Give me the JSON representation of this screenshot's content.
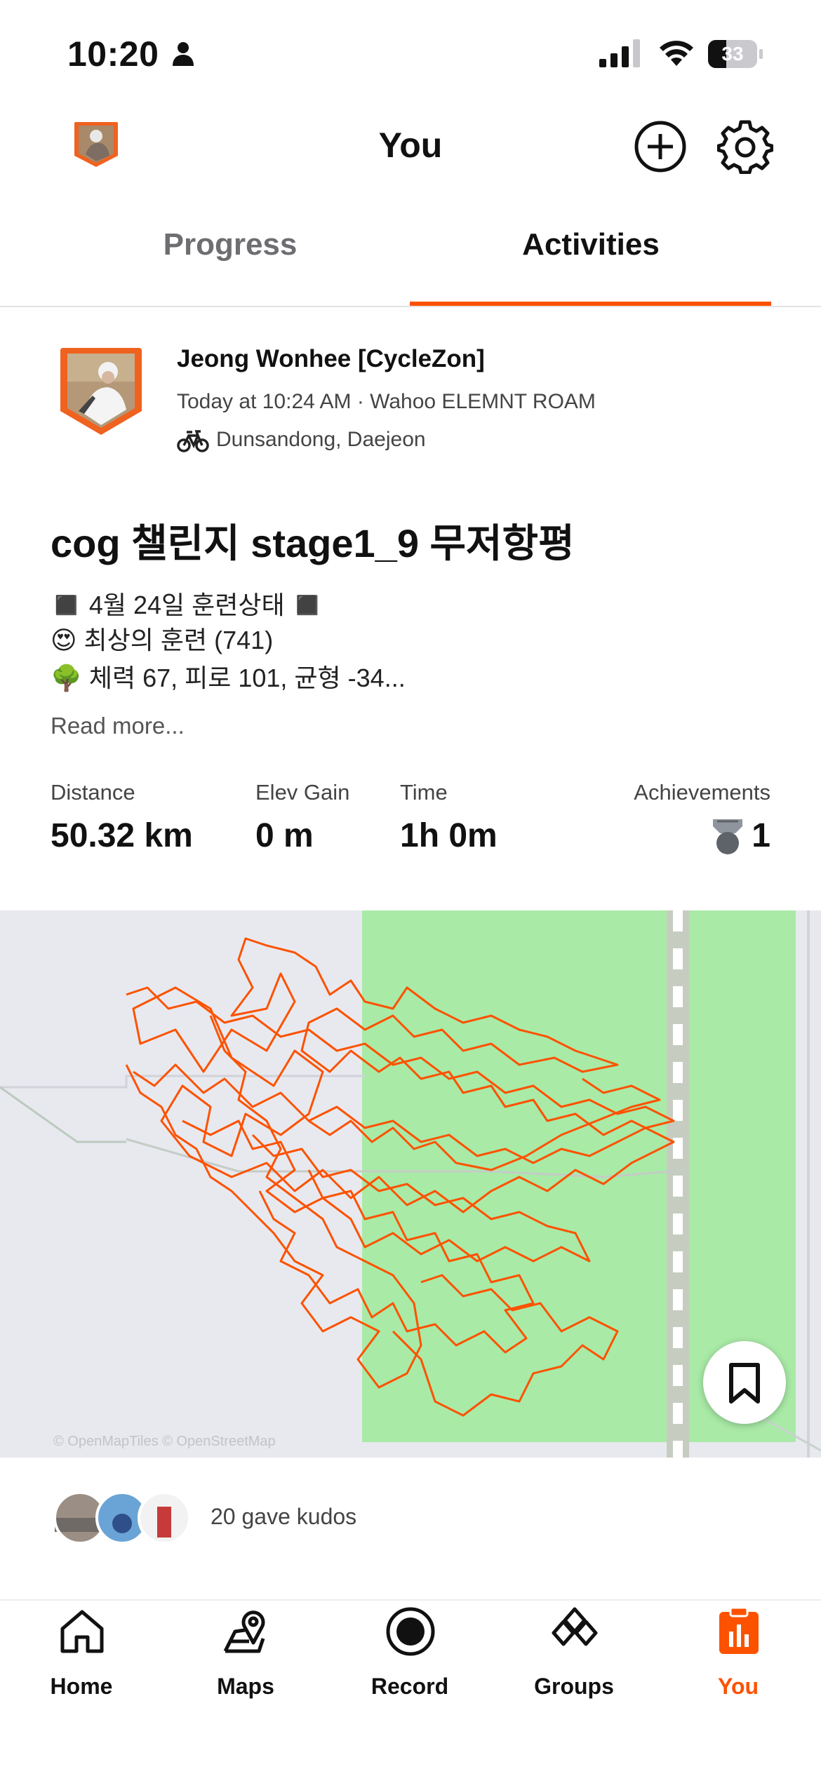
{
  "status_bar": {
    "time": "10:20",
    "battery": "33"
  },
  "header": {
    "title": "You"
  },
  "tabs": [
    {
      "label": "Progress"
    },
    {
      "label": "Activities"
    }
  ],
  "activity": {
    "athlete": "Jeong Wonhee  [CycleZon]",
    "meta": "Today at 10:24 AM · Wahoo ELEMNT ROAM",
    "location": "Dunsandong, Daejeon",
    "title": "cog 챌린지 stage1_9 무저항평",
    "description_lines": [
      "◼️ 4월 24일 훈련상태 ◼️",
      "😍 최상의 훈련 (741)",
      "🌳 체력 67, 피로 101, 균형 -34..."
    ],
    "read_more": "Read more...",
    "stats": [
      {
        "label": "Distance",
        "value": "50.32 km"
      },
      {
        "label": "Elev Gain",
        "value": "0 m"
      },
      {
        "label": "Time",
        "value": "1h 0m"
      }
    ],
    "achievements": {
      "label": "Achievements",
      "value": "1"
    },
    "map_credit": "© OpenMapTiles © OpenStreetMap",
    "kudos": "20 gave kudos"
  },
  "nav": [
    {
      "label": "Home",
      "icon": "home-icon"
    },
    {
      "label": "Maps",
      "icon": "maps-icon"
    },
    {
      "label": "Record",
      "icon": "record-icon"
    },
    {
      "label": "Groups",
      "icon": "groups-icon"
    },
    {
      "label": "You",
      "icon": "you-icon",
      "active": true
    }
  ],
  "colors": {
    "accent": "#fc5200",
    "map_green": "#a9eaa7",
    "map_bg": "#e8e9ef"
  }
}
